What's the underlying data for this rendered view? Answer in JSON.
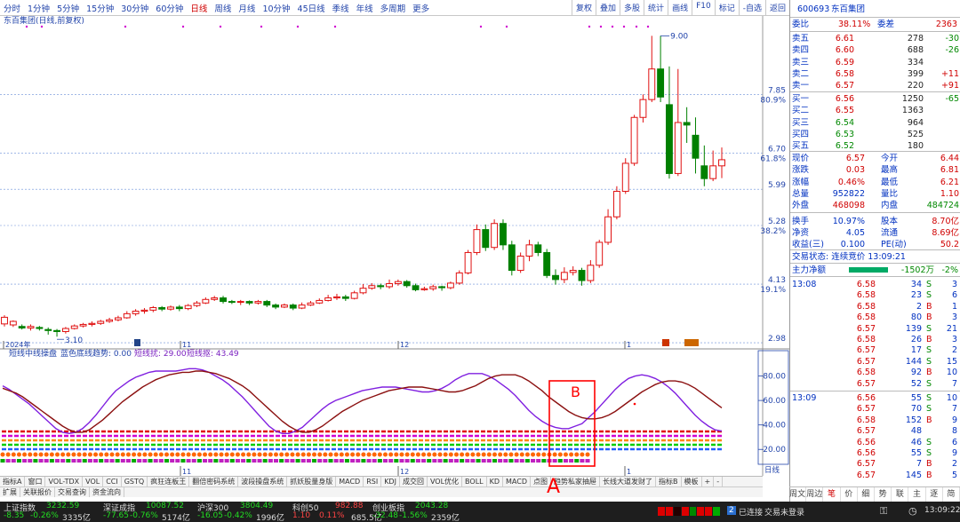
{
  "periods": [
    "分时",
    "1分钟",
    "5分钟",
    "15分钟",
    "30分钟",
    "60分钟",
    "日线",
    "周线",
    "月线",
    "10分钟",
    "45日线",
    "季线",
    "年线",
    "多周期",
    "更多"
  ],
  "active_period": "日线",
  "tool_buttons": [
    "复权",
    "叠加",
    "多股",
    "统计",
    "画线",
    "F10",
    "标记",
    "-自选",
    "返回"
  ],
  "chart_title": "东百集团(日线,前复权)",
  "price_axis": [
    {
      "label": "7.85",
      "pct": "80.9%"
    },
    {
      "label": "6.70",
      "pct": "61.8%"
    },
    {
      "label": "5.99",
      "pct": ""
    },
    {
      "label": "5.28",
      "pct": "38.2%"
    },
    {
      "label": "4.13",
      "pct": "19.1%"
    },
    {
      "label": "2.98",
      "pct": ""
    }
  ],
  "annot_high": "9.00",
  "annot_low": "3.10",
  "date_labels": [
    "2024年",
    "11",
    "12",
    "1"
  ],
  "indicator_header": {
    "name": "短线中线操盘",
    "trend": "蓝色底线趋势: 0.00",
    "short_buy": "短线扰: 29.00",
    "short_sell": "短线抠: 43.49"
  },
  "osc_axis": [
    "80.00",
    "60.00",
    "40.00",
    "20.00"
  ],
  "osc_bottom_label": "日线",
  "annotation_letters": {
    "box_label": "B",
    "bottom_label": "A"
  },
  "tabs1": [
    "指标A",
    "窗口",
    "VOL-TDX",
    "VOL",
    "CCI",
    "GSTQ",
    "疯狂连板王",
    "翻倍密码系统",
    "波段操盘系统",
    "抓妖股量身版",
    "MACD",
    "RSI",
    "KDJ",
    "成交回",
    "VOL优化",
    "BOLL",
    "KD",
    "MACD",
    "点图",
    "趋势私家抽屉",
    "长线大道发财了",
    "指标B",
    "模板",
    "+",
    "-"
  ],
  "tabs2": [
    "扩展",
    "关联报价",
    "交易查询",
    "资金流向"
  ],
  "quote": {
    "code": "600693",
    "name": "东百集团",
    "weibi_label": "委比",
    "weibi_val": "38.11%",
    "weicha_label": "委差",
    "weicha_val": "2363",
    "asks": [
      {
        "l": "卖五",
        "p": "6.61",
        "v": "278",
        "c": "-30"
      },
      {
        "l": "卖四",
        "p": "6.60",
        "v": "688",
        "c": "-26"
      },
      {
        "l": "卖三",
        "p": "6.59",
        "v": "334",
        "c": ""
      },
      {
        "l": "卖二",
        "p": "6.58",
        "v": "399",
        "c": "+11"
      },
      {
        "l": "卖一",
        "p": "6.57",
        "v": "220",
        "c": "+91"
      }
    ],
    "bids": [
      {
        "l": "买一",
        "p": "6.56",
        "v": "1250",
        "c": "-65"
      },
      {
        "l": "买二",
        "p": "6.55",
        "v": "1363",
        "c": ""
      },
      {
        "l": "买三",
        "p": "6.54",
        "v": "964",
        "c": ""
      },
      {
        "l": "买四",
        "p": "6.53",
        "v": "525",
        "c": ""
      },
      {
        "l": "买五",
        "p": "6.52",
        "v": "180",
        "c": ""
      }
    ],
    "stats": [
      {
        "a": "现价",
        "av": "6.57",
        "b": "今开",
        "bv": "6.44"
      },
      {
        "a": "涨跌",
        "av": "0.03",
        "b": "最高",
        "bv": "6.81"
      },
      {
        "a": "涨幅",
        "av": "0.46%",
        "b": "最低",
        "bv": "6.21"
      },
      {
        "a": "总量",
        "av": "952822",
        "b": "量比",
        "bv": "1.10"
      },
      {
        "a": "外盘",
        "av": "468098",
        "b": "内盘",
        "bv": "484724"
      },
      {
        "a": "换手",
        "av": "10.97%",
        "b": "股本",
        "bv": "8.70亿"
      },
      {
        "a": "净资",
        "av": "4.05",
        "b": "流通",
        "bv": "8.69亿"
      },
      {
        "a": "收益(三)",
        "av": "0.100",
        "b": "PE(动)",
        "bv": "50.2"
      }
    ],
    "trade_status": "交易状态: 连续竞价 13:09:21",
    "main_flow_label": "主力净额",
    "main_flow_val": "-1502万",
    "main_flow_pct": "-2%",
    "ticks": [
      {
        "t": "13:08",
        "p": "6.58",
        "v": "34",
        "s": "S",
        "n": "3"
      },
      {
        "t": "",
        "p": "6.58",
        "v": "23",
        "s": "S",
        "n": "6"
      },
      {
        "t": "",
        "p": "6.58",
        "v": "2",
        "s": "B",
        "n": "1"
      },
      {
        "t": "",
        "p": "6.58",
        "v": "80",
        "s": "B",
        "n": "3"
      },
      {
        "t": "",
        "p": "6.57",
        "v": "139",
        "s": "S",
        "n": "21"
      },
      {
        "t": "",
        "p": "6.58",
        "v": "26",
        "s": "B",
        "n": "3"
      },
      {
        "t": "",
        "p": "6.57",
        "v": "17",
        "s": "S",
        "n": "2"
      },
      {
        "t": "",
        "p": "6.57",
        "v": "144",
        "s": "S",
        "n": "15"
      },
      {
        "t": "",
        "p": "6.58",
        "v": "92",
        "s": "B",
        "n": "10"
      },
      {
        "t": "",
        "p": "6.57",
        "v": "52",
        "s": "S",
        "n": "7"
      },
      {
        "t": "13:09",
        "p": "6.56",
        "v": "55",
        "s": "S",
        "n": "10"
      },
      {
        "t": "",
        "p": "6.57",
        "v": "70",
        "s": "S",
        "n": "7"
      },
      {
        "t": "",
        "p": "6.58",
        "v": "152",
        "s": "B",
        "n": "9"
      },
      {
        "t": "",
        "p": "6.57",
        "v": "48",
        "s": "",
        "n": "8"
      },
      {
        "t": "",
        "p": "6.56",
        "v": "46",
        "s": "S",
        "n": "6"
      },
      {
        "t": "",
        "p": "6.56",
        "v": "55",
        "s": "S",
        "n": "9"
      },
      {
        "t": "",
        "p": "6.57",
        "v": "7",
        "s": "B",
        "n": "2"
      },
      {
        "t": "",
        "p": "6.57",
        "v": "145",
        "s": "B",
        "n": "5"
      }
    ],
    "rtabs": [
      "周文F10",
      "周边栏",
      "笔",
      "价",
      "细",
      "势",
      "联",
      "主",
      "逐",
      "简"
    ]
  },
  "status": {
    "idx": [
      {
        "n": "上证指数",
        "v": "3232.59",
        "c": "-8.35",
        "pct": "-0.26%",
        "a": "3335亿"
      },
      {
        "n": "深证成指",
        "v": "10087.52",
        "c": "-77.65",
        "pct": "-0.76%",
        "a": "5174亿"
      },
      {
        "n": "沪深300",
        "v": "3804.49",
        "c": "-16.05",
        "pct": "-0.42%",
        "a": "1996亿"
      },
      {
        "n": "科创50",
        "v": "982.88",
        "c": "1.10",
        "pct": "0.11%",
        "a": "685.5亿"
      },
      {
        "n": "创业板指",
        "v": "2043.28",
        "c": "-32.48",
        "pct": "-1.56%",
        "a": "2359亿"
      }
    ],
    "conn": "已连接",
    "trade": "交易未登录",
    "time": "13:09:22"
  },
  "chart_data": {
    "type": "candlestick",
    "title": "东百集团(日线,前复权)",
    "price_ticks": [
      7.85,
      6.7,
      5.99,
      5.28,
      4.13,
      2.98
    ],
    "ylim": [
      2.86,
      9.25
    ],
    "candles": [
      [
        3.35,
        3.48,
        3.3,
        3.52
      ],
      [
        3.33,
        3.4,
        3.29,
        3.42
      ],
      [
        3.3,
        3.27,
        3.24,
        3.34
      ],
      [
        3.27,
        3.3,
        3.22,
        3.34
      ],
      [
        3.28,
        3.26,
        3.22,
        3.31
      ],
      [
        3.24,
        3.22,
        3.14,
        3.28
      ],
      [
        3.22,
        3.2,
        3.1,
        3.25
      ],
      [
        3.2,
        3.26,
        3.16,
        3.29
      ],
      [
        3.26,
        3.31,
        3.24,
        3.34
      ],
      [
        3.31,
        3.34,
        3.28,
        3.37
      ],
      [
        3.34,
        3.36,
        3.3,
        3.4
      ],
      [
        3.36,
        3.4,
        3.33,
        3.43
      ],
      [
        3.4,
        3.43,
        3.37,
        3.47
      ],
      [
        3.43,
        3.47,
        3.4,
        3.51
      ],
      [
        3.47,
        3.55,
        3.45,
        3.6
      ],
      [
        3.55,
        3.6,
        3.51,
        3.64
      ],
      [
        3.6,
        3.62,
        3.55,
        3.66
      ],
      [
        3.62,
        3.67,
        3.58,
        3.7
      ],
      [
        3.67,
        3.64,
        3.6,
        3.7
      ],
      [
        3.64,
        3.68,
        3.61,
        3.71
      ],
      [
        3.68,
        3.65,
        3.6,
        3.72
      ],
      [
        3.65,
        3.71,
        3.62,
        3.74
      ],
      [
        3.71,
        3.76,
        3.68,
        3.8
      ],
      [
        3.76,
        3.83,
        3.74,
        3.87
      ],
      [
        3.83,
        3.86,
        3.8,
        3.9
      ],
      [
        3.86,
        3.79,
        3.75,
        3.9
      ],
      [
        3.79,
        3.78,
        3.74,
        3.82
      ],
      [
        3.78,
        3.79,
        3.72,
        3.82
      ],
      [
        3.79,
        3.76,
        3.72,
        3.81
      ],
      [
        3.76,
        3.79,
        3.73,
        3.82
      ],
      [
        3.79,
        3.72,
        3.68,
        3.82
      ],
      [
        3.72,
        3.68,
        3.64,
        3.75
      ],
      [
        3.68,
        3.72,
        3.66,
        3.75
      ],
      [
        3.72,
        3.66,
        3.62,
        3.75
      ],
      [
        3.66,
        3.72,
        3.64,
        3.77
      ],
      [
        3.72,
        3.76,
        3.7,
        3.8
      ],
      [
        3.76,
        3.81,
        3.74,
        3.85
      ],
      [
        3.81,
        3.86,
        3.79,
        3.92
      ],
      [
        3.86,
        3.88,
        3.82,
        3.94
      ],
      [
        3.88,
        3.85,
        3.8,
        3.92
      ],
      [
        3.85,
        3.96,
        3.83,
        4.0
      ],
      [
        3.96,
        4.05,
        3.93,
        4.13
      ],
      [
        4.05,
        4.1,
        4.02,
        4.15
      ],
      [
        4.1,
        4.08,
        4.03,
        4.14
      ],
      [
        4.08,
        4.14,
        4.04,
        4.22
      ],
      [
        4.14,
        4.18,
        4.1,
        4.22
      ],
      [
        4.18,
        4.1,
        4.06,
        4.21
      ],
      [
        4.1,
        4.02,
        3.99,
        4.14
      ],
      [
        4.02,
        4.04,
        4.0,
        4.08
      ],
      [
        4.04,
        4.08,
        4.0,
        4.12
      ],
      [
        4.08,
        4.06,
        4.0,
        4.1
      ],
      [
        4.06,
        4.15,
        4.03,
        4.18
      ],
      [
        4.15,
        4.35,
        4.12,
        4.4
      ],
      [
        4.35,
        4.75,
        4.32,
        4.8
      ],
      [
        4.75,
        5.2,
        4.7,
        5.3
      ],
      [
        5.2,
        4.85,
        4.78,
        5.3
      ],
      [
        4.85,
        5.32,
        4.8,
        5.4
      ],
      [
        5.32,
        4.9,
        4.8,
        5.4
      ],
      [
        4.9,
        4.4,
        4.3,
        4.98
      ],
      [
        4.4,
        4.68,
        4.35,
        4.75
      ],
      [
        4.68,
        4.9,
        4.58,
        5.0
      ],
      [
        4.9,
        4.75,
        4.68,
        4.96
      ],
      [
        4.75,
        4.3,
        4.25,
        4.82
      ],
      [
        4.3,
        4.22,
        4.12,
        4.42
      ],
      [
        4.22,
        4.36,
        4.15,
        4.46
      ],
      [
        4.36,
        4.4,
        4.3,
        4.48
      ],
      [
        4.4,
        4.2,
        4.1,
        4.45
      ],
      [
        4.2,
        4.5,
        4.15,
        4.6
      ],
      [
        4.5,
        4.95,
        4.45,
        5.0
      ],
      [
        4.95,
        5.45,
        4.9,
        5.6
      ],
      [
        5.45,
        5.95,
        5.4,
        6.05
      ],
      [
        5.95,
        6.5,
        5.9,
        6.6
      ],
      [
        6.5,
        7.4,
        6.45,
        7.45
      ],
      [
        7.4,
        7.75,
        7.3,
        7.85
      ],
      [
        7.75,
        8.35,
        7.7,
        9.0
      ],
      [
        8.35,
        7.8,
        7.7,
        9.0
      ],
      [
        7.65,
        6.3,
        6.2,
        8.4
      ],
      [
        6.3,
        7.3,
        6.25,
        8.35
      ],
      [
        7.3,
        7.25,
        6.9,
        7.6
      ],
      [
        7.05,
        6.6,
        6.3,
        7.4
      ],
      [
        6.45,
        6.2,
        6.05,
        6.85
      ],
      [
        6.2,
        6.45,
        6.15,
        6.75
      ],
      [
        6.45,
        6.57,
        6.21,
        6.81
      ]
    ],
    "osc_ylim": [
      10,
      100
    ],
    "osc_fast": [
      72,
      69,
      65,
      61,
      57,
      52,
      47,
      42,
      37,
      34,
      33,
      34,
      37,
      42,
      48,
      55,
      62,
      68,
      72,
      76,
      79,
      81,
      83,
      84,
      84,
      84,
      84,
      85,
      86,
      86,
      85,
      83,
      80,
      77,
      73,
      68,
      63,
      57,
      51,
      45,
      39,
      35,
      33,
      33,
      35,
      38,
      43,
      48,
      53,
      57,
      60,
      62,
      64,
      66,
      68,
      69,
      70,
      71,
      71,
      71,
      70,
      69,
      68,
      67,
      67,
      68,
      70,
      73,
      77,
      80,
      82,
      82,
      82,
      80,
      77,
      73,
      69,
      64,
      58,
      52,
      47,
      43,
      40,
      38,
      37,
      37,
      39,
      41,
      46,
      51,
      57,
      63,
      69,
      74,
      78,
      80,
      81,
      80,
      78,
      75,
      71,
      66,
      60,
      54,
      48,
      43,
      39,
      36,
      35
    ],
    "osc_slow": [
      70,
      68,
      66,
      63,
      59,
      55,
      51,
      47,
      43,
      39,
      36,
      34,
      34,
      36,
      40,
      44,
      49,
      54,
      59,
      63,
      67,
      71,
      74,
      77,
      79,
      81,
      82,
      83,
      83,
      84,
      84,
      83,
      82,
      80,
      78,
      75,
      72,
      68,
      63,
      58,
      53,
      48,
      43,
      39,
      36,
      34,
      34,
      36,
      39,
      43,
      47,
      51,
      54,
      57,
      60,
      62,
      64,
      66,
      68,
      69,
      70,
      71,
      71,
      71,
      70,
      69,
      68,
      67,
      67,
      68,
      70,
      72,
      75,
      78,
      80,
      81,
      81,
      81,
      79,
      76,
      72,
      68,
      63,
      59,
      55,
      51,
      48,
      46,
      45,
      45,
      46,
      48,
      51,
      55,
      59,
      63,
      67,
      70,
      73,
      75,
      76,
      76,
      75,
      73,
      70,
      66,
      62,
      58,
      54
    ]
  }
}
